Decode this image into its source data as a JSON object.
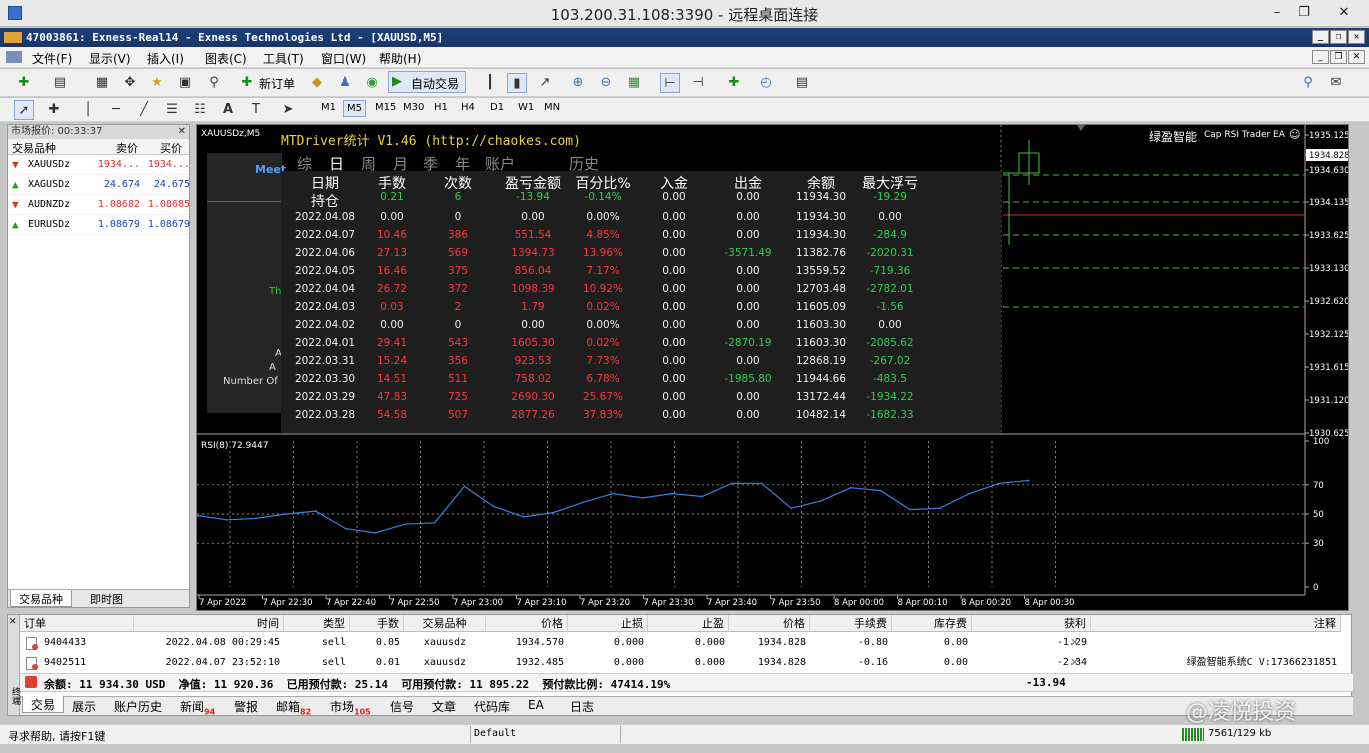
{
  "rdp": {
    "title": "103.200.31.108:3390 - 远程桌面连接"
  },
  "app": {
    "title": "47003861: Exness-Real14 - Exness Technologies Ltd - [XAUUSD,M5]"
  },
  "menu": [
    "文件(F)",
    "显示(V)",
    "插入(I)",
    "图表(C)",
    "工具(T)",
    "窗口(W)",
    "帮助(H)"
  ],
  "toolbar": {
    "new_order": "新订单",
    "auto_trading": "自动交易"
  },
  "timeframes": [
    "M1",
    "M5",
    "M15",
    "M30",
    "H1",
    "H4",
    "D1",
    "W1",
    "MN"
  ],
  "market_watch": {
    "title": "市场报价: 00:33:37",
    "col_symbol": "交易品种",
    "col_bid": "卖价",
    "col_ask": "买价",
    "rows": [
      {
        "symbol": "XAUUSDz",
        "bid": "1934...",
        "ask": "1934...",
        "dir": "down"
      },
      {
        "symbol": "XAGUSDz",
        "bid": "24.674",
        "ask": "24.675",
        "dir": "up"
      },
      {
        "symbol": "AUDNZDz",
        "bid": "1.08682",
        "ask": "1.08685",
        "dir": "down"
      },
      {
        "symbol": "EURUSDz",
        "bid": "1.08679",
        "ask": "1.08679",
        "dir": "up"
      }
    ],
    "tabs": [
      "交易品种",
      "即时图"
    ]
  },
  "chart": {
    "symbol_label": "XAUUSDz,M5",
    "ea_label": "绿盈智能",
    "ea_name": "Cap RSI Trader EA",
    "price_ticks": [
      "1935.125",
      "1934.828",
      "1934.630",
      "1934.135",
      "1933.625",
      "1933.130",
      "1932.620",
      "1932.125",
      "1931.615",
      "1931.120",
      "1930.625"
    ],
    "time_ticks": [
      "7 Apr 2022",
      "7 Apr 22:30",
      "7 Apr 22:40",
      "7 Apr 22:50",
      "7 Apr 23:00",
      "7 Apr 23:10",
      "7 Apr 23:20",
      "7 Apr 23:30",
      "7 Apr 23:40",
      "7 Apr 23:50",
      "8 Apr 00:00",
      "8 Apr 00:10",
      "8 Apr 00:20",
      "8 Apr 00:30"
    ],
    "rsi_label": "RSI(8) 72.9447",
    "rsi_ticks": [
      "100",
      "70",
      "50",
      "30",
      "0"
    ],
    "hidden_panel": {
      "meet": "Meet",
      "th": "Th",
      "a1": "A",
      "a2": "A",
      "number_of": "Number Of"
    }
  },
  "chart_data": {
    "type": "line",
    "title": "RSI(8) 72.9447",
    "xlabel": "",
    "ylabel": "",
    "ylim": [
      0,
      100
    ],
    "x": [
      "7 Apr 2022",
      "7 Apr 22:30",
      "7 Apr 22:40",
      "7 Apr 22:50",
      "7 Apr 23:00",
      "7 Apr 23:10",
      "7 Apr 23:20",
      "7 Apr 23:30",
      "7 Apr 23:40",
      "7 Apr 23:50",
      "8 Apr 00:00",
      "8 Apr 00:10",
      "8 Apr 00:20",
      "8 Apr 00:30"
    ],
    "series": [
      {
        "name": "RSI(8)",
        "values": [
          49,
          46,
          47,
          50,
          52,
          40,
          37,
          43,
          44,
          69,
          55,
          48,
          51,
          58,
          64,
          61,
          64,
          62,
          71,
          71,
          54,
          59,
          68,
          66,
          53,
          54,
          64,
          71,
          73
        ]
      }
    ]
  },
  "overlay": {
    "title": "MTDriver统计 V1.46 (http://chaokes.com)",
    "tabs": [
      "综",
      "日",
      "周",
      "月",
      "季",
      "年",
      "账户",
      "历史"
    ],
    "headers": [
      "日期",
      "手数",
      "次数",
      "盈亏金额",
      "百分比%",
      "入金",
      "出金",
      "余额",
      "最大浮亏"
    ],
    "rows": [
      {
        "date": "持仓",
        "lots": "0.21",
        "count": "6",
        "pnl": "-13.94",
        "pct": "-0.14%",
        "dep": "0.00",
        "wd": "0.00",
        "bal": "11934.30",
        "dd": "-19.29",
        "c": "g"
      },
      {
        "date": "2022.04.08",
        "lots": "0.00",
        "count": "0",
        "pnl": "0.00",
        "pct": "0.00%",
        "dep": "0.00",
        "wd": "0.00",
        "bal": "11934.30",
        "dd": "0.00",
        "c": "w"
      },
      {
        "date": "2022.04.07",
        "lots": "10.46",
        "count": "386",
        "pnl": "551.54",
        "pct": "4.85%",
        "dep": "0.00",
        "wd": "0.00",
        "bal": "11934.30",
        "dd": "-284.9",
        "c": "r"
      },
      {
        "date": "2022.04.06",
        "lots": "27.13",
        "count": "569",
        "pnl": "1394.73",
        "pct": "13.96%",
        "dep": "0.00",
        "wd": "-3571.49",
        "bal": "11382.76",
        "dd": "-2020.31",
        "c": "r"
      },
      {
        "date": "2022.04.05",
        "lots": "16.46",
        "count": "375",
        "pnl": "856.04",
        "pct": "7.17%",
        "dep": "0.00",
        "wd": "0.00",
        "bal": "13559.52",
        "dd": "-719.36",
        "c": "r"
      },
      {
        "date": "2022.04.04",
        "lots": "26.72",
        "count": "372",
        "pnl": "1098.39",
        "pct": "10.92%",
        "dep": "0.00",
        "wd": "0.00",
        "bal": "12703.48",
        "dd": "-2782.01",
        "c": "r"
      },
      {
        "date": "2022.04.03",
        "lots": "0.03",
        "count": "2",
        "pnl": "1.79",
        "pct": "0.02%",
        "dep": "0.00",
        "wd": "0.00",
        "bal": "11605.09",
        "dd": "-1.56",
        "c": "r"
      },
      {
        "date": "2022.04.02",
        "lots": "0.00",
        "count": "0",
        "pnl": "0.00",
        "pct": "0.00%",
        "dep": "0.00",
        "wd": "0.00",
        "bal": "11603.30",
        "dd": "0.00",
        "c": "w"
      },
      {
        "date": "2022.04.01",
        "lots": "29.41",
        "count": "543",
        "pnl": "1605.30",
        "pct": "0.02%",
        "dep": "0.00",
        "wd": "-2870.19",
        "bal": "11603.30",
        "dd": "-2085.62",
        "c": "r"
      },
      {
        "date": "2022.03.31",
        "lots": "15.24",
        "count": "356",
        "pnl": "923.53",
        "pct": "7.73%",
        "dep": "0.00",
        "wd": "0.00",
        "bal": "12868.19",
        "dd": "-267.02",
        "c": "r"
      },
      {
        "date": "2022.03.30",
        "lots": "14.51",
        "count": "511",
        "pnl": "758.02",
        "pct": "6.78%",
        "dep": "0.00",
        "wd": "-1985.80",
        "bal": "11944.66",
        "dd": "-483.5",
        "c": "r"
      },
      {
        "date": "2022.03.29",
        "lots": "47.83",
        "count": "725",
        "pnl": "2690.30",
        "pct": "25.67%",
        "dep": "0.00",
        "wd": "0.00",
        "bal": "13172.44",
        "dd": "-1934.22",
        "c": "r"
      },
      {
        "date": "2022.03.28",
        "lots": "54.58",
        "count": "507",
        "pnl": "2877.26",
        "pct": "37.83%",
        "dep": "0.00",
        "wd": "0.00",
        "bal": "10482.14",
        "dd": "-1682.33",
        "c": "r"
      }
    ]
  },
  "terminal": {
    "headers": [
      "订单",
      "时间",
      "类型",
      "手数",
      "交易品种",
      "价格",
      "止损",
      "止盈",
      "价格",
      "手续费",
      "库存费",
      "获利",
      "注释"
    ],
    "rows": [
      {
        "order": "9404433",
        "time": "2022.04.08 00:29:45",
        "type": "sell",
        "lots": "0.05",
        "symbol": "xauusdz",
        "price": "1934.570",
        "sl": "0.000",
        "tp": "0.000",
        "cur": "1934.828",
        "fee": "-0.80",
        "swap": "0.00",
        "profit": "-1.29",
        "comment": ""
      },
      {
        "order": "9402511",
        "time": "2022.04.07 23:52:10",
        "type": "sell",
        "lots": "0.01",
        "symbol": "xauusdz",
        "price": "1932.485",
        "sl": "0.000",
        "tp": "0.000",
        "cur": "1934.828",
        "fee": "-0.16",
        "swap": "0.00",
        "profit": "-2.34",
        "comment": "绿盈智能系统C V:17366231851"
      }
    ],
    "summary": "余额: 11 934.30 USD  净值: 11 920.36  已用预付款: 25.14  可用预付款: 11 895.22  预付款比例: 47414.19%",
    "total_profit": "-13.94",
    "tabs": [
      {
        "label": "交易",
        "badge": ""
      },
      {
        "label": "展示",
        "badge": ""
      },
      {
        "label": "账户历史",
        "badge": ""
      },
      {
        "label": "新闻",
        "badge": "94"
      },
      {
        "label": "警报",
        "badge": ""
      },
      {
        "label": "邮箱",
        "badge": "82"
      },
      {
        "label": "市场",
        "badge": "105"
      },
      {
        "label": "信号",
        "badge": ""
      },
      {
        "label": "文章",
        "badge": ""
      },
      {
        "label": "代码库",
        "badge": ""
      },
      {
        "label": "EA",
        "badge": ""
      },
      {
        "label": "日志",
        "badge": ""
      }
    ],
    "side_label": "终端"
  },
  "status": {
    "help": "寻求帮助, 请按F1键",
    "profile": "Default",
    "traffic": "7561/129 kb"
  },
  "watermark": "@凌悦投资",
  "colors": {
    "up": "#00c800",
    "down": "#ff3030",
    "grid": "#4a8a4a",
    "rsi": "#3d7fe0",
    "title_bg": "#1f3f7a"
  }
}
